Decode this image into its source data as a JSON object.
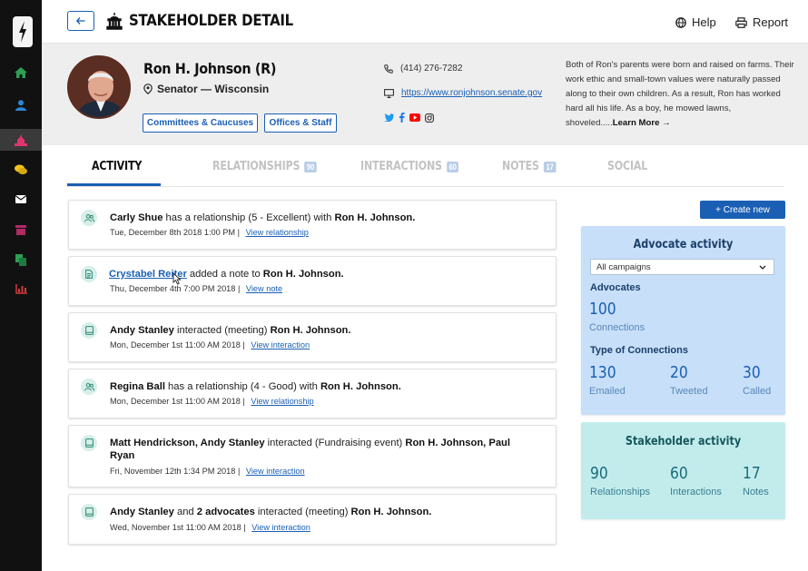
{
  "colors": {
    "accent": "#1a5fb4",
    "rail": "#111111",
    "advocate_bg": "#c7dff8",
    "stakeholder_bg": "#c2ecec",
    "active_rail": "#e0356e"
  },
  "rail": {
    "items": [
      {
        "icon": "home-icon",
        "color": "#2e9e55"
      },
      {
        "icon": "user-icon",
        "color": "#2b87d8"
      },
      {
        "icon": "capitol-icon",
        "color": "#e0356e"
      },
      {
        "icon": "chat-icon",
        "color": "#f2c21b"
      },
      {
        "icon": "mail-icon",
        "color": "#ffffff"
      },
      {
        "icon": "archive-icon",
        "color": "#b02a64"
      },
      {
        "icon": "copy-icon",
        "color": "#2e9e55"
      },
      {
        "icon": "chart-icon",
        "color": "#d23b3b"
      }
    ]
  },
  "header": {
    "title": "STAKEHOLDER DETAIL",
    "help": "Help",
    "report": "Report"
  },
  "profile": {
    "name": "Ron H. Johnson (R)",
    "role": "Senator — Wisconsin",
    "btn_committees": "Committees & Caucuses",
    "btn_offices": "Offices & Staff",
    "phone": "(414) 276-7282",
    "website": "https://www.ronjohnson.senate.gov",
    "bio": "Both of Ron's parents were born and raised on farms. Their work ethic and small-town values were naturally passed along to their own children. As a result, Ron has worked hard all his life. As a boy, he mowed lawns, shoveled.....",
    "learn_more": "Learn More →"
  },
  "tabs": [
    {
      "label": "ACTIVITY",
      "badge": ""
    },
    {
      "label": "RELATIONSHIPS",
      "badge": "90"
    },
    {
      "label": "INTERACTIONS",
      "badge": "60"
    },
    {
      "label": "NOTES",
      "badge": "17"
    },
    {
      "label": "SOCIAL",
      "badge": ""
    }
  ],
  "activity": [
    {
      "icon": "people-icon",
      "actor": "Carly Shue",
      "mid": " has a relationship (5 - Excellent) with ",
      "target": "Ron H. Johnson.",
      "date": "Tue, December 8th 2018 1:00 PM",
      "link": "View relationship"
    },
    {
      "icon": "note-icon",
      "actor": "Crystabel Reiter",
      "mid": " added a note to ",
      "target": "Ron H. Johnson.",
      "date": "Thu, December 4th 7:00 PM 2018",
      "link": "View note"
    },
    {
      "icon": "book-icon",
      "actor": "Andy Stanley",
      "mid": " interacted (meeting) ",
      "target": "Ron H. Johnson.",
      "date": "Mon, December 1st 11:00 AM 2018",
      "link": "View interaction"
    },
    {
      "icon": "people-icon",
      "actor": "Regina Ball",
      "mid": " has a relationship (4 - Good) with ",
      "target": "Ron H. Johnson.",
      "date": "Mon, December 1st 11:00 AM 2018",
      "link": "View relationship"
    },
    {
      "icon": "book-icon",
      "actor": "Matt Hendrickson, Andy Stanley",
      "mid": " interacted (Fundraising event) ",
      "target": "Ron H. Johnson, Paul Ryan",
      "date": "Fri, November 12th 1:34 PM 2018",
      "link": "View interaction"
    },
    {
      "icon": "book-icon",
      "actor": "Andy Stanley",
      "mid": " and ",
      "extra": "2 advocates",
      "mid2": " interacted (meeting) ",
      "target": "Ron H. Johnson.",
      "date": "Wed, November 1st 11:00 AM 2018",
      "link": "View interaction"
    }
  ],
  "sidebar": {
    "create_new": "+ Create new",
    "advocate": {
      "title": "Advocate activity",
      "campaign": "All campaigns",
      "advocates_label": "Advocates",
      "connections_num": "100",
      "connections_label": "Connections",
      "type_label": "Type of Connections",
      "emailed_num": "130",
      "emailed_label": "Emailed",
      "tweeted_num": "20",
      "tweeted_label": "Tweeted",
      "called_num": "30",
      "called_label": "Called"
    },
    "stakeholder": {
      "title": "Stakeholder activity",
      "rel_num": "90",
      "rel_label": "Relationships",
      "int_num": "60",
      "int_label": "Interactions",
      "notes_num": "17",
      "notes_label": "Notes"
    }
  }
}
